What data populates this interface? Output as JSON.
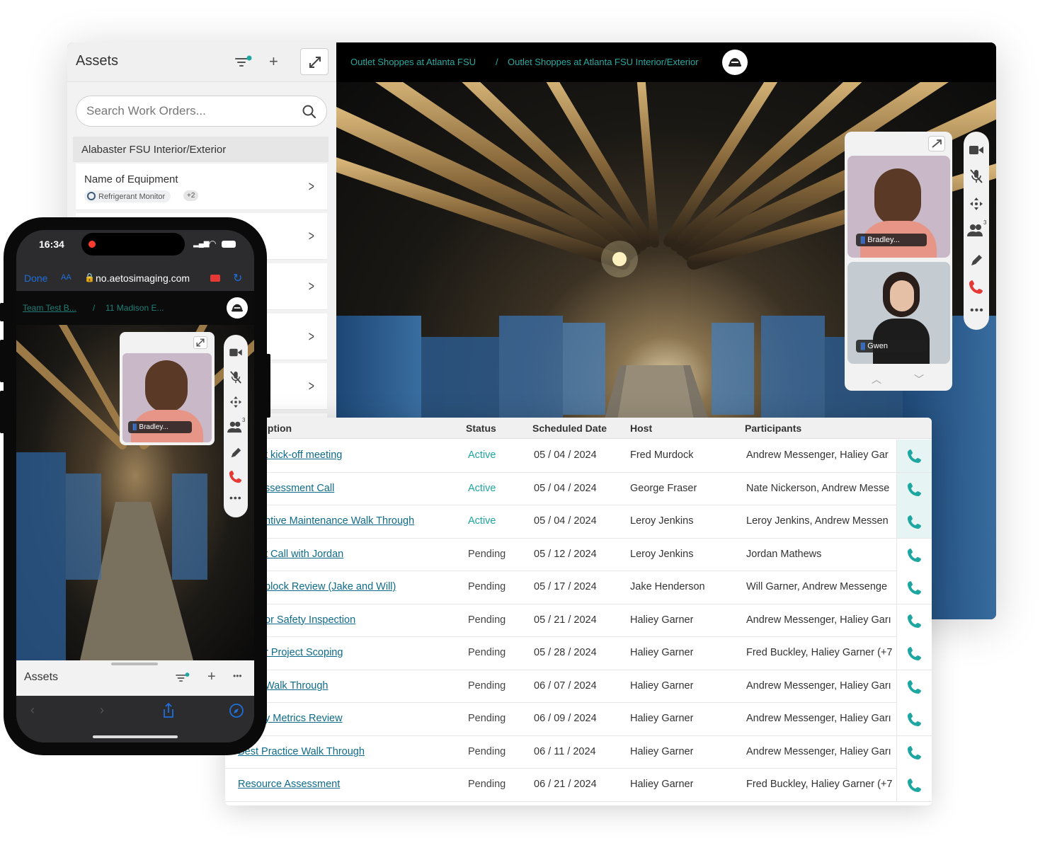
{
  "desktop": {
    "assets_panel": {
      "title": "Assets",
      "search_placeholder": "Search Work Orders...",
      "group_title": "Alabaster FSU Interior/Exterior",
      "first_item": {
        "name": "Name of Equipment",
        "tag": "Refrigerant Monitor",
        "more": "+2"
      }
    },
    "breadcrumb": [
      "Outlet Shoppes at Atlanta FSU",
      "/",
      "Outlet Shoppes at Atlanta FSU Interior/Exterior"
    ],
    "participants": [
      {
        "name": "Bradley..."
      },
      {
        "name": "Gwen"
      }
    ],
    "participant_count": "3",
    "controls": [
      "video-camera-icon",
      "mic-muted-icon",
      "move-icon",
      "participants-icon",
      "pen-icon",
      "hang-up-icon",
      "more-icon"
    ]
  },
  "table": {
    "headers": [
      "iption",
      "Status",
      "Scheduled Date",
      "Host",
      "Participants"
    ],
    "rows": [
      {
        "desc": "t kick-off meeting",
        "status": "Active",
        "date": "05 / 04 / 2024",
        "host": "Fred Murdock",
        "participants": "Andrew Messenger, Haliey Gar"
      },
      {
        "desc": "ssessment Call",
        "status": "Active",
        "date": "05 / 04 / 2024",
        "host": "George Fraser",
        "participants": "Nate Nickerson, Andrew Messe"
      },
      {
        "desc": "ntive Maintenance Walk Through",
        "status": "Active",
        "date": "05 / 04 / 2024",
        "host": "Leroy Jenkins",
        "participants": "Leroy Jenkins, Andrew Messen"
      },
      {
        "desc": "t Call with Jordan",
        "status": "Pending",
        "date": "05 / 12 / 2024",
        "host": "Leroy Jenkins",
        "participants": "Jordan Mathews"
      },
      {
        "desc": "block Review (Jake and Will)",
        "status": "Pending",
        "date": "05 / 17 / 2024",
        "host": "Jake Henderson",
        "participants": "Will Garner, Andrew Messenge"
      },
      {
        "desc": "or Safety Inspection",
        "status": "Pending",
        "date": "05 / 21 / 2024",
        "host": "Haliey Garner",
        "participants": "Andrew Messenger, Haliey Garı"
      },
      {
        "desc": "r Project Scoping",
        "status": "Pending",
        "date": "05 / 28 / 2024",
        "host": "Haliey Garner",
        "participants": "Fred Buckley, Haliey Garner (+7"
      },
      {
        "desc": "Walk Through",
        "status": "Pending",
        "date": "06 / 07 / 2024",
        "host": "Haliey Garner",
        "participants": "Andrew Messenger, Haliey Garı"
      },
      {
        "desc": "y Metrics Review",
        "status": "Pending",
        "date": "06 / 09 / 2024",
        "host": "Haliey Garner",
        "participants": "Andrew Messenger, Haliey Garı"
      },
      {
        "desc": "Best Practice Walk Through",
        "status": "Pending",
        "date": "06 / 11 / 2024",
        "host": "Haliey Garner",
        "participants": "Andrew Messenger, Haliey Garı"
      },
      {
        "desc": "Resource Assessment",
        "status": "Pending",
        "date": "06 / 21 / 2024",
        "host": "Haliey Garner",
        "participants": "Fred Buckley, Haliey Garner (+7"
      }
    ]
  },
  "phone": {
    "time": "16:34",
    "browser": {
      "done": "Done",
      "aa": "AA",
      "url": "no.aetosimaging.com"
    },
    "breadcrumb": [
      "Team Test B...",
      "/",
      "11 Madison E..."
    ],
    "participant": {
      "name": "Bradley..."
    },
    "participant_count": "3",
    "sheet_title": "Assets"
  },
  "colors": {
    "accent": "#1ea6a0",
    "link": "#0f6b8a",
    "hangup": "#e53935",
    "participant_bars": "#3b82f6"
  }
}
